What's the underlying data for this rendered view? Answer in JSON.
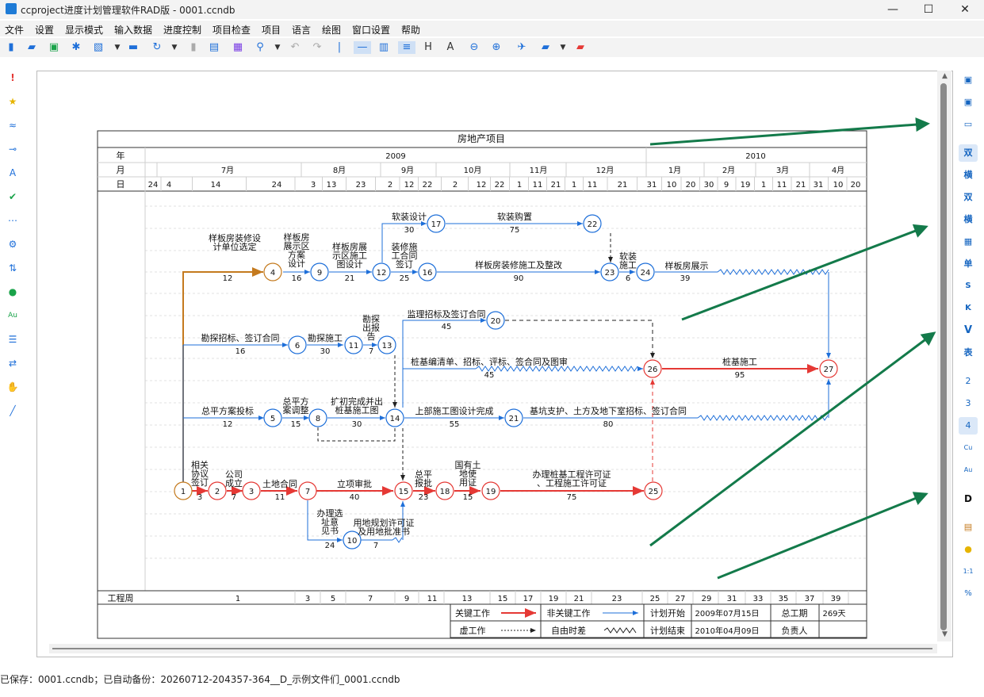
{
  "app": {
    "title": "ccproject进度计划管理软件RAD版 - 0001.ccndb",
    "min_label": "—",
    "max_label": "☐",
    "close_label": "✕"
  },
  "menu": [
    "文件",
    "设置",
    "显示模式",
    "输入数据",
    "进度控制",
    "项目检查",
    "项目",
    "语言",
    "绘图",
    "窗口设置",
    "帮助"
  ],
  "status": "已保存：0001.ccndb；已自动备份：20260712-204357-364__D_示例文件们_0001.ccndb",
  "right_toolbar": [
    "双",
    "横",
    "双",
    "横",
    "",
    "单",
    "S",
    "K",
    "V",
    "表",
    "2",
    "3",
    "4",
    "Cu",
    "Au",
    "D"
  ],
  "chart": {
    "title": "房地产项目",
    "row_labels": {
      "year": "年",
      "month": "月",
      "day": "日",
      "week": "工程周"
    },
    "years": [
      "2009",
      "2010"
    ],
    "months": [
      "7月",
      "8月",
      "9月",
      "10月",
      "11月",
      "12月",
      "1月",
      "2月",
      "3月",
      "4月"
    ],
    "days": [
      "24",
      "4",
      "14",
      "24",
      "3",
      "13",
      "23",
      "2",
      "12",
      "22",
      "2",
      "12",
      "22",
      "1",
      "11",
      "21",
      "1",
      "11",
      "21",
      "31",
      "10",
      "20",
      "30",
      "9",
      "19",
      "1",
      "11",
      "21",
      "31",
      "10",
      "20"
    ],
    "weeks": [
      "1",
      "3",
      "5",
      "7",
      "9",
      "11",
      "13",
      "15",
      "17",
      "19",
      "21",
      "23",
      "25",
      "27",
      "29",
      "31",
      "33",
      "35",
      "37",
      "39"
    ],
    "nodes": [
      "1",
      "2",
      "3",
      "4",
      "5",
      "6",
      "7",
      "8",
      "9",
      "10",
      "11",
      "12",
      "13",
      "14",
      "15",
      "16",
      "17",
      "18",
      "19",
      "20",
      "21",
      "22",
      "23",
      "24",
      "25",
      "26",
      "27"
    ],
    "activities": [
      {
        "name": "样板房装修设计单位选定",
        "dur": "12"
      },
      {
        "name": "样板房展示区方案设计",
        "dur": "16"
      },
      {
        "name": "样板房展示区施工图设计",
        "dur": "21"
      },
      {
        "name": "装修施工合同签订",
        "dur": "25"
      },
      {
        "name": "软装设计",
        "dur": "30"
      },
      {
        "name": "软装购置",
        "dur": "75"
      },
      {
        "name": "样板房装修施工及整改",
        "dur": "90"
      },
      {
        "name": "软装施工",
        "dur": "6"
      },
      {
        "name": "样板房展示",
        "dur": "39"
      },
      {
        "name": "勘探招标、签订合同",
        "dur": "16"
      },
      {
        "name": "勘探施工",
        "dur": "30"
      },
      {
        "name": "勘探出报告",
        "dur": "7"
      },
      {
        "name": "监理招标及签订合同",
        "dur": "45"
      },
      {
        "name": "桩基编清单、招标、评标、签合同及图审",
        "dur": "45"
      },
      {
        "name": "桩基施工",
        "dur": "95"
      },
      {
        "name": "总平方案投标",
        "dur": "12"
      },
      {
        "name": "总平方案调整",
        "dur": "15"
      },
      {
        "name": "扩初完成并出桩基施工图",
        "dur": "30"
      },
      {
        "name": "上部施工图设计完成",
        "dur": "55"
      },
      {
        "name": "基坑支护、土方及地下室招标、签订合同",
        "dur": "80"
      },
      {
        "name": "相关协议签订",
        "dur": "3"
      },
      {
        "name": "公司成立",
        "dur": "7"
      },
      {
        "name": "土地合同",
        "dur": "11"
      },
      {
        "name": "立项审批",
        "dur": "40"
      },
      {
        "name": "总平报批",
        "dur": "23"
      },
      {
        "name": "国有土地使用证",
        "dur": "15"
      },
      {
        "name": "办理桩基工程许可证、工程施工许可证",
        "dur": "75"
      },
      {
        "name": "办理选址意见书",
        "dur": "24"
      },
      {
        "name": "用地规划许可证及用地批准书",
        "dur": "7"
      }
    ],
    "legend": {
      "critical": "关键工作",
      "noncritical": "非关键工作",
      "dummy": "虚工作",
      "float": "自由时差",
      "plan_start_label": "计划开始",
      "plan_start": "2009年07月15日",
      "plan_end_label": "计划结束",
      "plan_end": "2010年04月09日",
      "total_label": "总工期",
      "total": "269天",
      "owner_label": "负责人"
    }
  },
  "colors": {
    "critical": "#e53935",
    "noncritical": "#1e6fd9",
    "orange": "#c47a1e",
    "arrow": "#137a4a"
  }
}
